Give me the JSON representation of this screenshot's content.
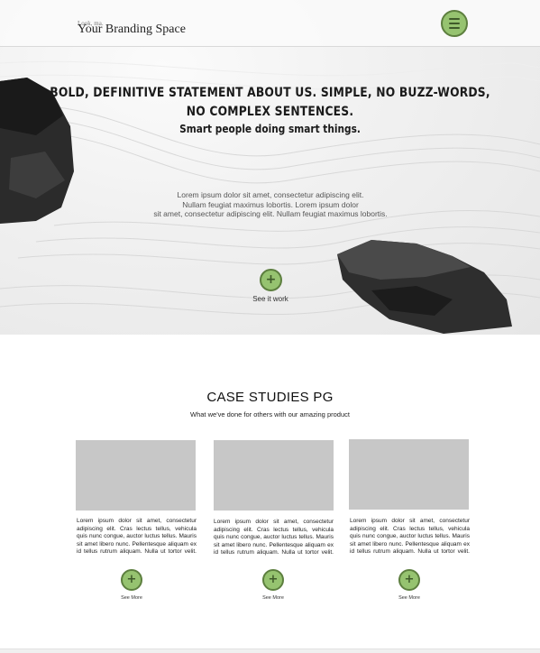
{
  "header": {
    "brand_small": "Look, ma.",
    "brand_name": "Your Branding Space",
    "menu_icon": "hamburger-icon"
  },
  "hero": {
    "title_line1": "BOLD, DEFINITIVE STATEMENT ABOUT US. SIMPLE, NO BUZZ-WORDS,",
    "title_line2": "NO COMPLEX SENTENCES.",
    "subtitle": "Smart people doing smart things.",
    "body_line1": "Lorem ipsum dolor sit amet, consectetur adipiscing elit.",
    "body_line2": "Nullam feugiat maximus lobortis. Lorem ipsum dolor",
    "body_line3": "sit amet, consectetur adipiscing elit. Nullam feugiat maximus lobortis.",
    "cta_icon": "+",
    "cta_label": "See it work"
  },
  "case_studies": {
    "title": "CASE STUDIES PG",
    "subtitle": "What we've done for others with our amazing product",
    "cards": [
      {
        "text": "Lorem ipsum dolor sit amet, consectetur adipiscing elit. Cras lectus tellus, vehicula quis nunc congue, auctor luctus tellus. Mauris sit amet libero nunc. Pellentesque aliquam ex id tellus rutrum aliquam. Nulla ut tortor velit. Vestibulum enim massa, hendrerit sed pellen-",
        "icon": "+",
        "link": "See More"
      },
      {
        "text": "Lorem ipsum dolor sit amet, consectetur adipiscing elit. Cras lectus tellus, vehicula quis nunc congue, auctor luctus tellus. Mauris sit amet libero nunc. Pellentesque aliquam ex id tellus rutrum aliquam. Nulla ut tortor velit. Vestibulum enim massa, hendrerit sed pellen-",
        "icon": "+",
        "link": "See More"
      },
      {
        "text": "Lorem ipsum dolor sit amet, consectetur adipiscing elit. Cras lectus tellus, vehicula quis nunc congue, auctor luctus tellus. Mauris sit amet libero nunc. Pellentesque aliquam ex id tellus rutrum aliquam. Nulla ut tortor velit. Vestibulum enim massa, hendrerit sed pellen-",
        "icon": "+",
        "link": "See More"
      }
    ]
  },
  "colors": {
    "accent_green": "#96c370",
    "accent_border": "#5d7f3f",
    "placeholder_gray": "#c7c7c7"
  }
}
